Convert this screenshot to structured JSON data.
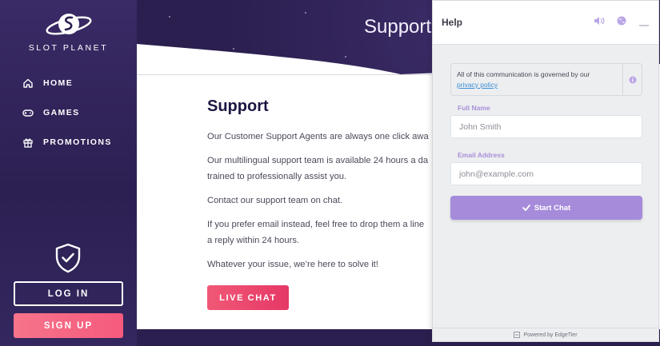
{
  "brand": {
    "name": "SLOT PLANET"
  },
  "nav": [
    {
      "label": "HOME",
      "icon": "home-icon"
    },
    {
      "label": "GAMES",
      "icon": "gamepad-icon"
    },
    {
      "label": "PROMOTIONS",
      "icon": "gift-icon"
    }
  ],
  "auth": {
    "login": "LOG IN",
    "signup": "SIGN UP"
  },
  "hero": {
    "title": "Support"
  },
  "article": {
    "heading": "Support",
    "paragraphs": [
      "Our Customer Support Agents are always one click awa",
      "Our multilingual support team is available 24 hours a da",
      "trained to professionally assist you.",
      "Contact our support team on chat.",
      "If you prefer email instead, feel free to drop them a line",
      "a reply within 24 hours.",
      "Whatever your issue, we’re here to solve it!"
    ],
    "cta": "LIVE CHAT"
  },
  "chat": {
    "title": "Help",
    "notice_text": "All of this communication is governed by our",
    "notice_link": "privacy policy",
    "name_label": "Full Name",
    "name_placeholder": "John Smith",
    "email_label": "Email Address",
    "email_placeholder": "john@example.com",
    "start_button": "Start Chat",
    "powered_by": "Powered by EdgeTier"
  },
  "colors": {
    "sidebar_bg": "#2c2052",
    "accent_pink": "#f55a7d",
    "chat_purple": "#a68bdb",
    "link_blue": "#3e8fd6"
  }
}
